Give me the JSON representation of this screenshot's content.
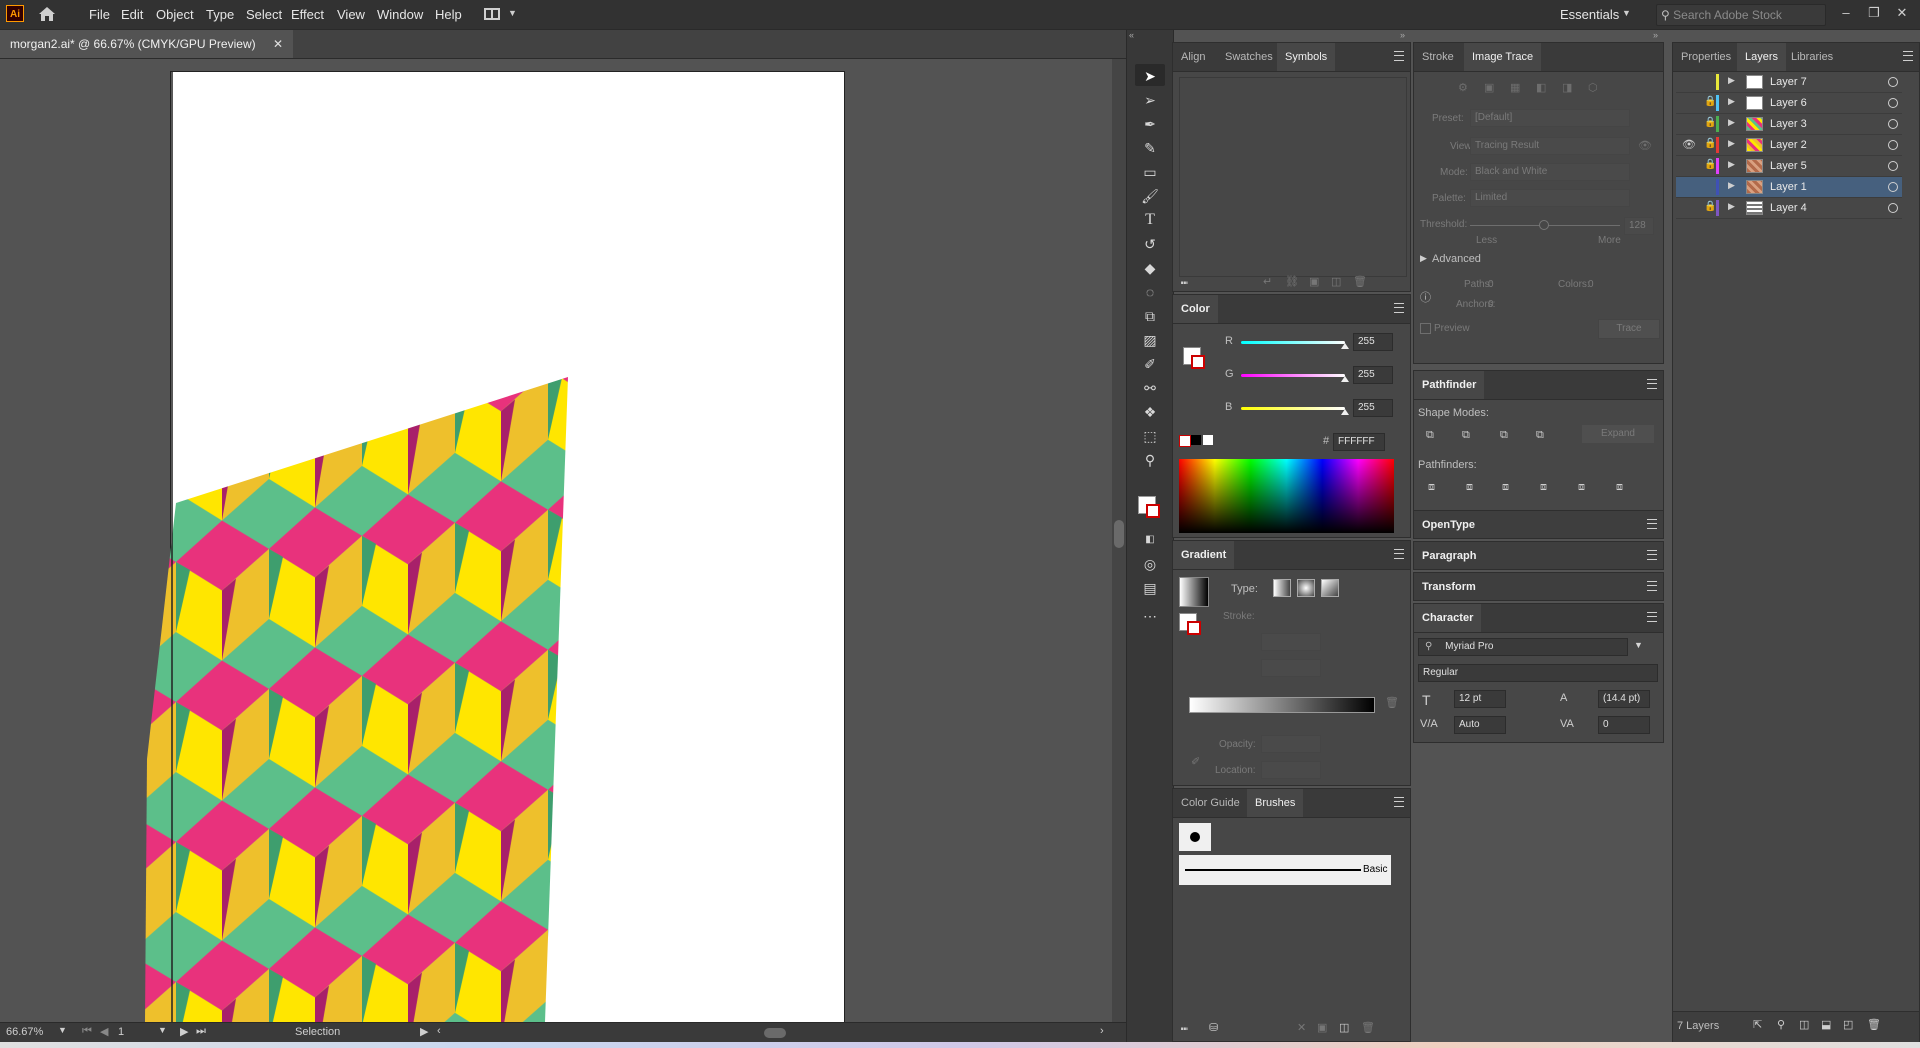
{
  "app": {
    "logo": "Ai",
    "home_icon": "home-icon"
  },
  "menu": [
    "File",
    "Edit",
    "Object",
    "Type",
    "Select",
    "Effect",
    "View",
    "Window",
    "Help"
  ],
  "workspace": "Essentials",
  "stock_search_placeholder": "Search Adobe Stock",
  "document_tab": "morgan2.ai* @ 66.67% (CMYK/GPU Preview)",
  "status": {
    "zoom": "66.67%",
    "artboard_num": "1",
    "tool": "Selection"
  },
  "panels": {
    "top_left_tabs": [
      "Align",
      "Swatches",
      "Symbols"
    ],
    "top_mid_tabs": [
      "Stroke",
      "Image Trace"
    ],
    "top_right_tabs": [
      "Properties",
      "Layers",
      "Libraries"
    ]
  },
  "image_trace": {
    "preset_label": "Preset:",
    "preset_value": "[Default]",
    "view_label": "View:",
    "view_value": "Tracing Result",
    "mode_label": "Mode:",
    "mode_value": "Black and White",
    "palette_label": "Palette:",
    "palette_value": "Limited",
    "threshold_label": "Threshold:",
    "threshold_value": "128",
    "less": "Less",
    "more": "More",
    "advanced": "Advanced",
    "paths_label": "Paths:",
    "paths_value": "0",
    "colors_label": "Colors:",
    "colors_value": "0",
    "anchors_label": "Anchors:",
    "anchors_value": "0",
    "preview": "Preview",
    "trace_button": "Trace"
  },
  "color": {
    "title": "Color",
    "r_label": "R",
    "r": "255",
    "g_label": "G",
    "g": "255",
    "b_label": "B",
    "b": "255",
    "hex": "FFFFFF"
  },
  "gradient": {
    "title": "Gradient",
    "type_label": "Type:",
    "stroke_label": "Stroke:",
    "opacity_label": "Opacity:",
    "location_label": "Location:"
  },
  "brushes_tabs": [
    "Color Guide",
    "Brushes"
  ],
  "brush_basic": "Basic",
  "pathfinder": {
    "title": "Pathfinder",
    "shape_modes": "Shape Modes:",
    "expand": "Expand",
    "pathfinders": "Pathfinders:"
  },
  "collapsed": {
    "opentype": "OpenType",
    "paragraph": "Paragraph",
    "transform": "Transform",
    "character": "Character"
  },
  "character": {
    "font": "Myriad Pro",
    "style": "Regular",
    "size": "12 pt",
    "leading": "(14.4 pt)",
    "kerning": "Auto",
    "tracking": "0"
  },
  "layers": [
    {
      "name": "Layer 7",
      "color": "#e8e83a",
      "locked": false,
      "visible": false,
      "thumb": "white"
    },
    {
      "name": "Layer 6",
      "color": "#4fc3f7",
      "locked": true,
      "visible": false,
      "thumb": "white"
    },
    {
      "name": "Layer 3",
      "color": "#4caf50",
      "locked": true,
      "visible": false,
      "thumb": "pattern-green"
    },
    {
      "name": "Layer 2",
      "color": "#e53935",
      "locked": true,
      "visible": true,
      "thumb": "pattern-yellow"
    },
    {
      "name": "Layer 5",
      "color": "#e040fb",
      "locked": true,
      "visible": false,
      "thumb": "pattern-brown"
    },
    {
      "name": "Layer 1",
      "color": "#3f51b5",
      "locked": false,
      "visible": false,
      "thumb": "pattern-brown",
      "selected": true
    },
    {
      "name": "Layer 4",
      "color": "#7e57c2",
      "locked": true,
      "visible": false,
      "thumb": "pattern-grid"
    }
  ],
  "layers_count": "7 Layers",
  "artwork_colors": {
    "pink": "#e8327c",
    "yellow": "#ffe600",
    "gold": "#eec02c",
    "green": "#5cbf8a",
    "darkgreen": "#3e9e6e",
    "magenta": "#a8206a"
  }
}
